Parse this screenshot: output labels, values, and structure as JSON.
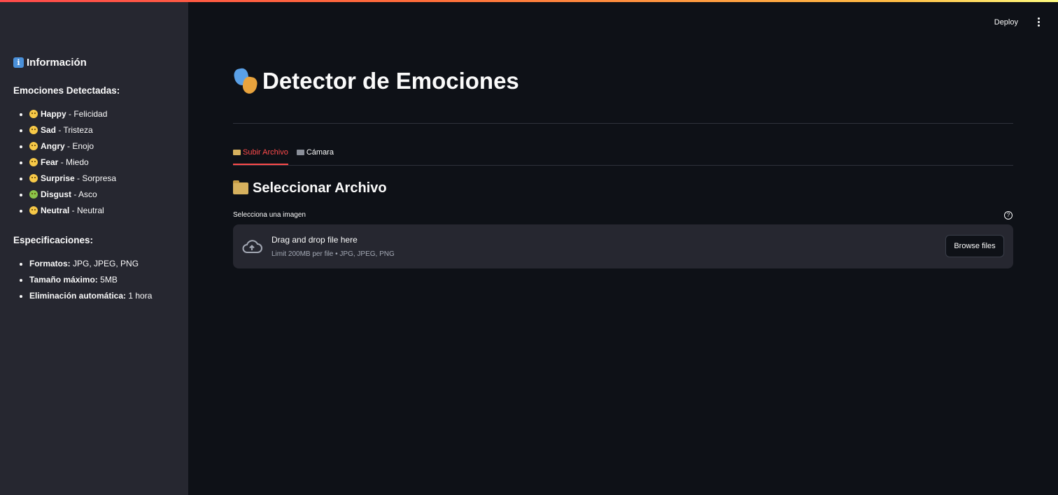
{
  "header": {
    "deploy_label": "Deploy"
  },
  "sidebar": {
    "title": "Información",
    "emotions_heading": "Emociones Detectadas:",
    "emotions": [
      {
        "name": "Happy",
        "desc": " - Felicidad"
      },
      {
        "name": "Sad",
        "desc": " - Tristeza"
      },
      {
        "name": "Angry",
        "desc": " - Enojo"
      },
      {
        "name": "Fear",
        "desc": " - Miedo"
      },
      {
        "name": "Surprise",
        "desc": " - Sorpresa"
      },
      {
        "name": "Disgust",
        "desc": " - Asco"
      },
      {
        "name": "Neutral",
        "desc": " - Neutral"
      }
    ],
    "specs_heading": "Especificaciones:",
    "specs": [
      {
        "key": "Formatos:",
        "value": " JPG, JPEG, PNG"
      },
      {
        "key": "Tamaño máximo:",
        "value": " 5MB"
      },
      {
        "key": "Eliminación automática:",
        "value": " 1 hora"
      }
    ]
  },
  "main": {
    "title": "Detector de Emociones",
    "tabs": [
      {
        "label": "Subir Archivo",
        "active": true
      },
      {
        "label": "Cámara",
        "active": false
      }
    ],
    "section_title": "Seleccionar Archivo",
    "uploader_label": "Selecciona una imagen",
    "dropzone": {
      "main_text": "Drag and drop file here",
      "sub_text": "Limit 200MB per file • JPG, JPEG, PNG",
      "button_label": "Browse files"
    }
  }
}
